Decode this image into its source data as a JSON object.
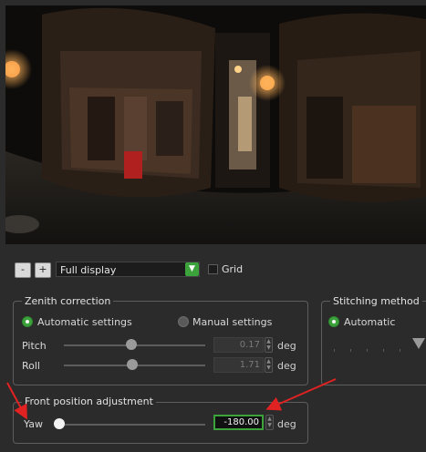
{
  "toolbar": {
    "minus_label": "-",
    "plus_label": "+",
    "display_mode": "Full display",
    "grid_label": "Grid"
  },
  "zenith": {
    "title": "Zenith correction",
    "auto_label": "Automatic settings",
    "manual_label": "Manual settings",
    "selected": "Automatic settings",
    "pitch_label": "Pitch",
    "pitch_value": "0.17",
    "roll_label": "Roll",
    "roll_value": "1.71",
    "unit": "deg"
  },
  "stitching": {
    "title": "Stitching method",
    "auto_label": "Automatic",
    "selected": "Automatic"
  },
  "front": {
    "title": "Front position adjustment",
    "yaw_label": "Yaw",
    "yaw_value": "-180.00",
    "unit": "deg"
  },
  "annotations": {
    "arrow_color": "#e02222",
    "highlight_color": "#3ca33c"
  }
}
